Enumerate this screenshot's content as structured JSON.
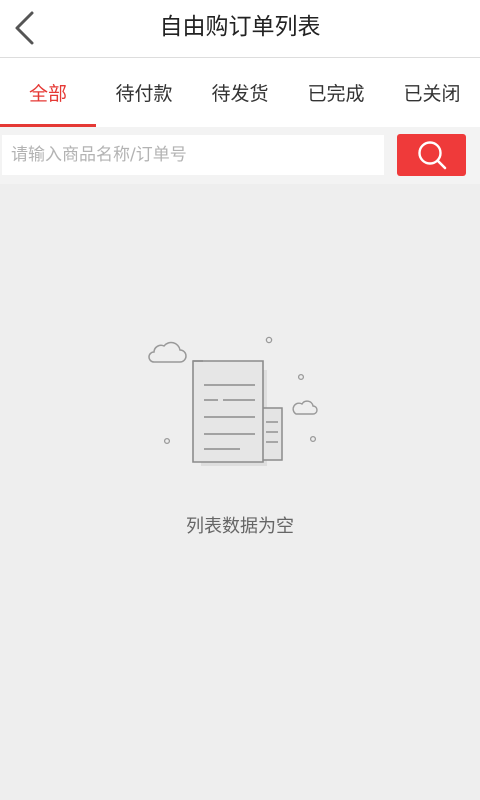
{
  "header": {
    "title": "自由购订单列表",
    "back_icon": "chevron-left-icon"
  },
  "tabs": [
    {
      "label": "全部",
      "active": true
    },
    {
      "label": "待付款",
      "active": false
    },
    {
      "label": "待发货",
      "active": false
    },
    {
      "label": "已完成",
      "active": false
    },
    {
      "label": "已关闭",
      "active": false
    }
  ],
  "search": {
    "placeholder": "请输入商品名称/订单号",
    "value": "",
    "button_icon": "search-icon"
  },
  "empty_state": {
    "icon": "empty-document-illustration",
    "message": "列表数据为空"
  },
  "colors": {
    "accent": "#e53935",
    "search_button": "#ef3a3a",
    "background": "#eeeeee"
  }
}
